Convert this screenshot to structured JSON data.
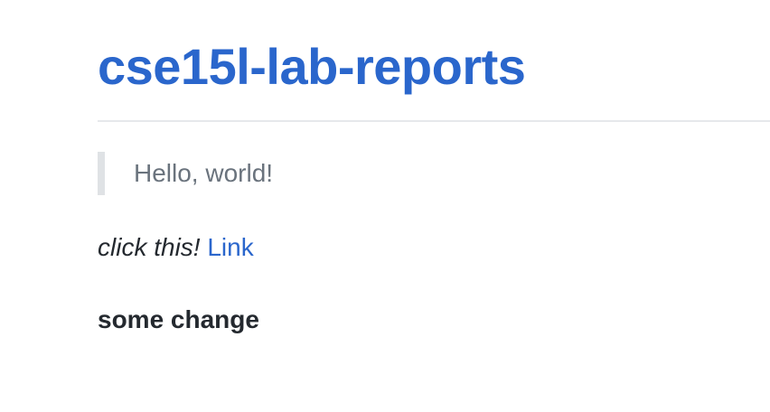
{
  "header": {
    "title": "cse15l-lab-reports"
  },
  "content": {
    "blockquote": "Hello, world!",
    "italic_text": "click this!",
    "link_text": "Link",
    "bold_text": "some change"
  },
  "colors": {
    "title": "#2a66cc",
    "link": "#2a66cc",
    "body_text": "#24292f",
    "quote_text": "#6a737d",
    "quote_border": "#dfe2e5",
    "rule": "#e6e8eb"
  }
}
